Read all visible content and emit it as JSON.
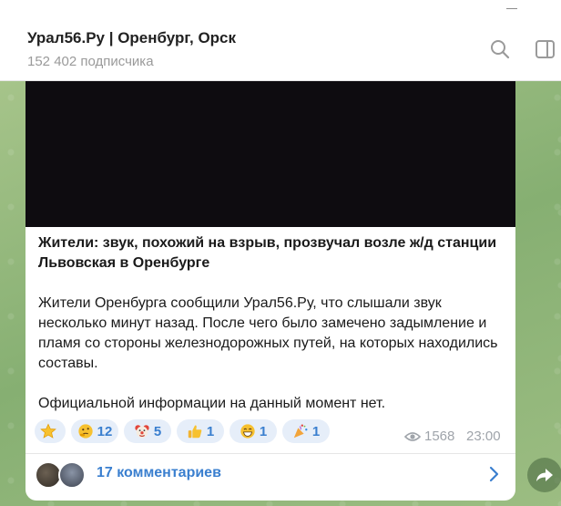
{
  "channel": {
    "title": "Урал56.Ру | Оренбург, Орск",
    "subscribers": "152 402 подписчика"
  },
  "header_icons": [
    "search-icon",
    "side-panel-icon"
  ],
  "post": {
    "title": "Жители: звук, похожий на взрыв, прозвучал возле ж/д станции Львовская в Оренбурге",
    "paragraphs": [
      "Жители Оренбурга сообщили Урал56.Ру, что слышали звук несколько минут назад. После чего было замечено задымление и пламя со стороны железнодорожных путей, на которых находились составы.",
      "Официальной информации на данный момент нет."
    ],
    "reactions": [
      {
        "icon": "star-icon",
        "count": ""
      },
      {
        "icon": "thinking-face-icon",
        "count": "12"
      },
      {
        "icon": "clown-face-icon",
        "count": "5"
      },
      {
        "icon": "thumbs-up-icon",
        "count": "1"
      },
      {
        "icon": "grinning-face-icon",
        "count": "1"
      },
      {
        "icon": "party-popper-icon",
        "count": "1"
      }
    ],
    "views": "1568",
    "time": "23:00",
    "comments": "17 комментариев"
  },
  "colors": {
    "accent": "#3a7fcf",
    "chat_background": "#8fb57d",
    "reaction_background": "#e6eef9"
  }
}
